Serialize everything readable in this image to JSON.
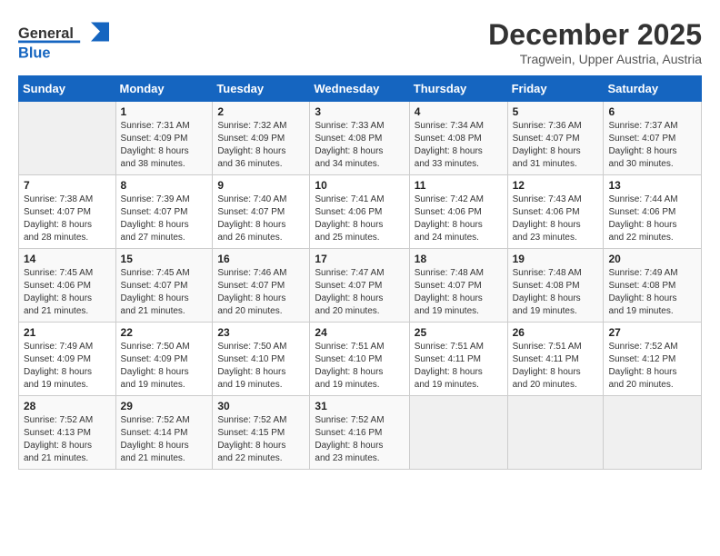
{
  "header": {
    "logo_general": "General",
    "logo_blue": "Blue",
    "month": "December 2025",
    "location": "Tragwein, Upper Austria, Austria"
  },
  "weekdays": [
    "Sunday",
    "Monday",
    "Tuesday",
    "Wednesday",
    "Thursday",
    "Friday",
    "Saturday"
  ],
  "weeks": [
    [
      {
        "day": "",
        "info": ""
      },
      {
        "day": "1",
        "info": "Sunrise: 7:31 AM\nSunset: 4:09 PM\nDaylight: 8 hours\nand 38 minutes."
      },
      {
        "day": "2",
        "info": "Sunrise: 7:32 AM\nSunset: 4:09 PM\nDaylight: 8 hours\nand 36 minutes."
      },
      {
        "day": "3",
        "info": "Sunrise: 7:33 AM\nSunset: 4:08 PM\nDaylight: 8 hours\nand 34 minutes."
      },
      {
        "day": "4",
        "info": "Sunrise: 7:34 AM\nSunset: 4:08 PM\nDaylight: 8 hours\nand 33 minutes."
      },
      {
        "day": "5",
        "info": "Sunrise: 7:36 AM\nSunset: 4:07 PM\nDaylight: 8 hours\nand 31 minutes."
      },
      {
        "day": "6",
        "info": "Sunrise: 7:37 AM\nSunset: 4:07 PM\nDaylight: 8 hours\nand 30 minutes."
      }
    ],
    [
      {
        "day": "7",
        "info": "Sunrise: 7:38 AM\nSunset: 4:07 PM\nDaylight: 8 hours\nand 28 minutes."
      },
      {
        "day": "8",
        "info": "Sunrise: 7:39 AM\nSunset: 4:07 PM\nDaylight: 8 hours\nand 27 minutes."
      },
      {
        "day": "9",
        "info": "Sunrise: 7:40 AM\nSunset: 4:07 PM\nDaylight: 8 hours\nand 26 minutes."
      },
      {
        "day": "10",
        "info": "Sunrise: 7:41 AM\nSunset: 4:06 PM\nDaylight: 8 hours\nand 25 minutes."
      },
      {
        "day": "11",
        "info": "Sunrise: 7:42 AM\nSunset: 4:06 PM\nDaylight: 8 hours\nand 24 minutes."
      },
      {
        "day": "12",
        "info": "Sunrise: 7:43 AM\nSunset: 4:06 PM\nDaylight: 8 hours\nand 23 minutes."
      },
      {
        "day": "13",
        "info": "Sunrise: 7:44 AM\nSunset: 4:06 PM\nDaylight: 8 hours\nand 22 minutes."
      }
    ],
    [
      {
        "day": "14",
        "info": "Sunrise: 7:45 AM\nSunset: 4:06 PM\nDaylight: 8 hours\nand 21 minutes."
      },
      {
        "day": "15",
        "info": "Sunrise: 7:45 AM\nSunset: 4:07 PM\nDaylight: 8 hours\nand 21 minutes."
      },
      {
        "day": "16",
        "info": "Sunrise: 7:46 AM\nSunset: 4:07 PM\nDaylight: 8 hours\nand 20 minutes."
      },
      {
        "day": "17",
        "info": "Sunrise: 7:47 AM\nSunset: 4:07 PM\nDaylight: 8 hours\nand 20 minutes."
      },
      {
        "day": "18",
        "info": "Sunrise: 7:48 AM\nSunset: 4:07 PM\nDaylight: 8 hours\nand 19 minutes."
      },
      {
        "day": "19",
        "info": "Sunrise: 7:48 AM\nSunset: 4:08 PM\nDaylight: 8 hours\nand 19 minutes."
      },
      {
        "day": "20",
        "info": "Sunrise: 7:49 AM\nSunset: 4:08 PM\nDaylight: 8 hours\nand 19 minutes."
      }
    ],
    [
      {
        "day": "21",
        "info": "Sunrise: 7:49 AM\nSunset: 4:09 PM\nDaylight: 8 hours\nand 19 minutes."
      },
      {
        "day": "22",
        "info": "Sunrise: 7:50 AM\nSunset: 4:09 PM\nDaylight: 8 hours\nand 19 minutes."
      },
      {
        "day": "23",
        "info": "Sunrise: 7:50 AM\nSunset: 4:10 PM\nDaylight: 8 hours\nand 19 minutes."
      },
      {
        "day": "24",
        "info": "Sunrise: 7:51 AM\nSunset: 4:10 PM\nDaylight: 8 hours\nand 19 minutes."
      },
      {
        "day": "25",
        "info": "Sunrise: 7:51 AM\nSunset: 4:11 PM\nDaylight: 8 hours\nand 19 minutes."
      },
      {
        "day": "26",
        "info": "Sunrise: 7:51 AM\nSunset: 4:11 PM\nDaylight: 8 hours\nand 20 minutes."
      },
      {
        "day": "27",
        "info": "Sunrise: 7:52 AM\nSunset: 4:12 PM\nDaylight: 8 hours\nand 20 minutes."
      }
    ],
    [
      {
        "day": "28",
        "info": "Sunrise: 7:52 AM\nSunset: 4:13 PM\nDaylight: 8 hours\nand 21 minutes."
      },
      {
        "day": "29",
        "info": "Sunrise: 7:52 AM\nSunset: 4:14 PM\nDaylight: 8 hours\nand 21 minutes."
      },
      {
        "day": "30",
        "info": "Sunrise: 7:52 AM\nSunset: 4:15 PM\nDaylight: 8 hours\nand 22 minutes."
      },
      {
        "day": "31",
        "info": "Sunrise: 7:52 AM\nSunset: 4:16 PM\nDaylight: 8 hours\nand 23 minutes."
      },
      {
        "day": "",
        "info": ""
      },
      {
        "day": "",
        "info": ""
      },
      {
        "day": "",
        "info": ""
      }
    ]
  ]
}
